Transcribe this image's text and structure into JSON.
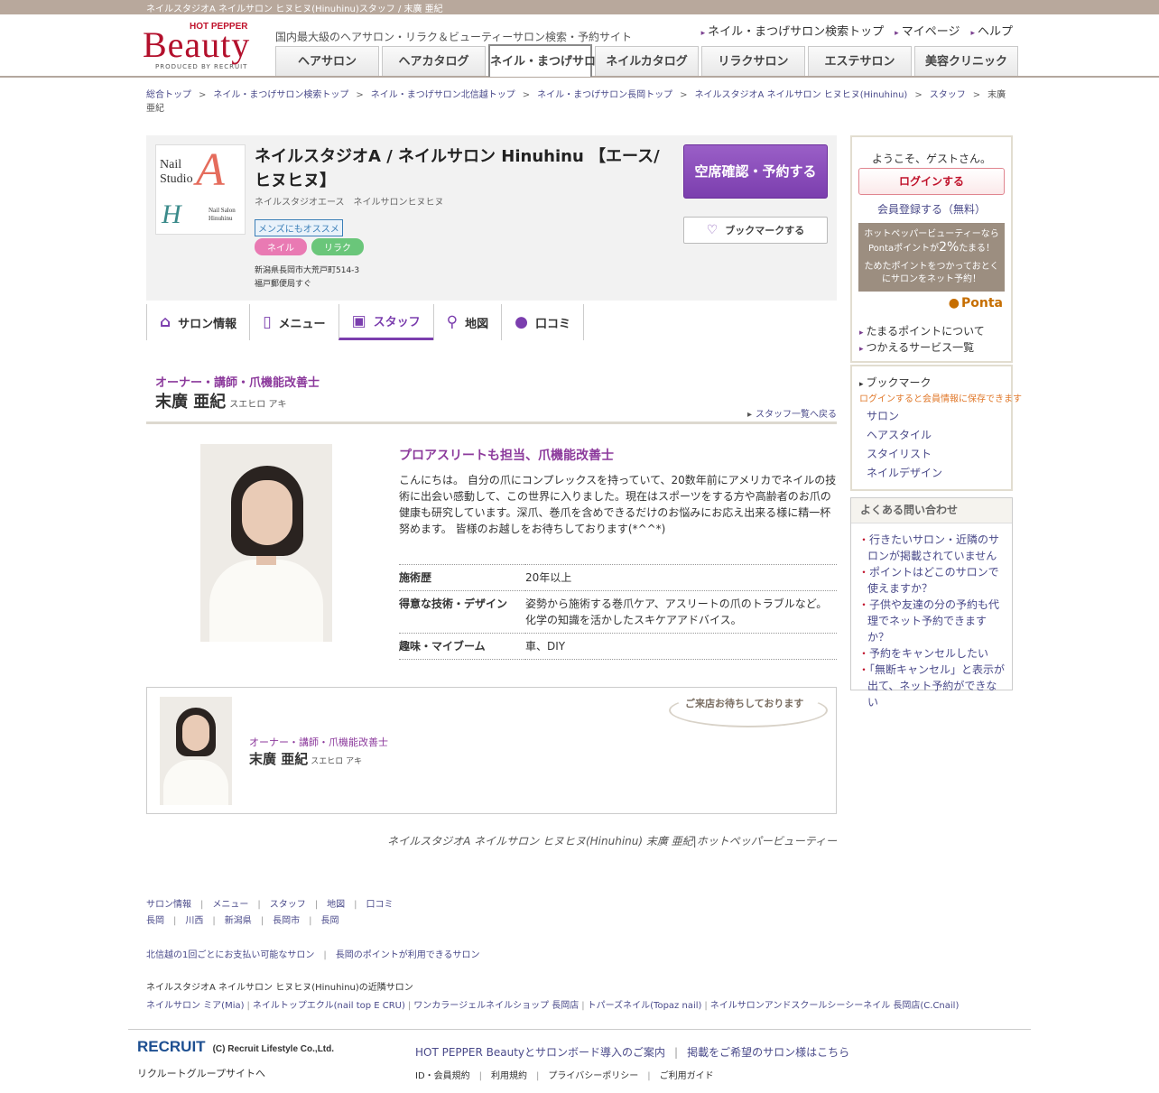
{
  "topbar": {
    "title": "ネイルスタジオA ネイルサロン ヒヌヒヌ(Hinuhinu)スタッフ / 末廣 亜紀"
  },
  "header": {
    "logo_hotpepper": "HOT PEPPER",
    "logo_beauty": "Beauty",
    "logo_produced": "PRODUCED BY RECRUIT",
    "tagline": "国内最大級のヘアサロン・リラク＆ビューティーサロン検索・予約サイト",
    "top_links": [
      "ネイル・まつげサロン検索トップ",
      "マイページ",
      "ヘルプ"
    ],
    "tabs": [
      "ヘアサロン",
      "ヘアカタログ",
      "ネイル・まつげサロン",
      "ネイルカタログ",
      "リラクサロン",
      "エステサロン",
      "美容クリニック"
    ],
    "active_tab": "ネイル・まつげサロン"
  },
  "breadcrumb": [
    "総合トップ",
    "ネイル・まつげサロン検索トップ",
    "ネイル・まつげサロン北信越トップ",
    "ネイル・まつげサロン長岡トップ",
    "ネイルスタジオA ネイルサロン ヒヌヒヌ(Hinuhinu)",
    "スタッフ",
    "末廣 亜紀"
  ],
  "breadcrumb_sep": ">",
  "salon": {
    "logo_text_1": "Nail",
    "logo_text_2": "Studio",
    "logo_letter_a": "A",
    "logo_letter_h": "H",
    "logo_sub_1": "Nail Salon",
    "logo_sub_2": "Hinuhinu",
    "name": "ネイルスタジオA / ネイルサロン Hinuhinu 【エース/ヒヌヒヌ】",
    "kana": "ネイルスタジオエース　ネイルサロンヒヌヒヌ",
    "mens_badge": "メンズにもオススメ",
    "tags": [
      "ネイル",
      "リラク"
    ],
    "address": "新潟県長岡市大荒戸町514-3",
    "access": "福戸郵便局すぐ",
    "reserve_label": "空席確認・予約する",
    "bookmark_label": "ブックマークする"
  },
  "subnav": [
    {
      "label": "サロン情報",
      "icon": "home-icon"
    },
    {
      "label": "メニュー",
      "icon": "menu-book-icon"
    },
    {
      "label": "スタッフ",
      "icon": "staff-card-icon"
    },
    {
      "label": "地図",
      "icon": "map-pin-icon"
    },
    {
      "label": "口コミ",
      "icon": "chat-bubble-icon"
    }
  ],
  "staff": {
    "role": "オーナー・講師・爪機能改善士",
    "name": "末廣 亜紀",
    "kana": "スエヒロ アキ",
    "back_link": "スタッフ一覧へ戻る",
    "catch": "プロアスリートも担当、爪機能改善士",
    "description": "こんにちは。 自分の爪にコンプレックスを持っていて、20数年前にアメリカでネイルの技術に出会い感動して、この世界に入りました。現在はスポーツをする方や高齢者のお爪の健康も研究しています。深爪、巻爪を含めできるだけのお悩みにお応え出来る様に精一杯努めます。 皆様のお越しをお待ちしております(*^^*)",
    "details": [
      {
        "key": "施術歴",
        "value": "20年以上"
      },
      {
        "key": "得意な技術・デザイン",
        "value": "姿勢から施術する巻爪ケア、アスリートの爪のトラブルなど。化学の知識を活かしたスキケアアドバイス。"
      },
      {
        "key": "趣味・マイブーム",
        "value": "車、DIY"
      }
    ]
  },
  "message_box": {
    "bubble": "ご来店お待ちしております",
    "role": "オーナー・講師・爪機能改善士",
    "name": "末廣 亜紀",
    "kana": "スエヒロ アキ"
  },
  "footline": "ネイルスタジオA ネイルサロン ヒヌヒヌ(Hinuhinu) 末廣 亜紀|ホットペッパービューティー",
  "sidebar": {
    "welcome": "ようこそ、ゲストさん。",
    "login": "ログインする",
    "register": "会員登録する（無料）",
    "ponta_line1": "ホットペッパービューティーなら",
    "ponta_line2a": "Pontaポイントが",
    "ponta_pct": "2%",
    "ponta_line2b": "たまる！",
    "ponta_line3": "ためたポイントをつかっておとくにサロンをネット予約！",
    "ponta_logo": "Ponta",
    "ponta_links": [
      "たまるポイントについて",
      "つかえるサービス一覧"
    ],
    "bookmark_title": "ブックマーク",
    "bookmark_note": "ログインすると会員情報に保存できます",
    "bookmark_items": [
      "サロン",
      "ヘアスタイル",
      "スタイリスト",
      "ネイルデザイン"
    ],
    "faq_title": "よくある問い合わせ",
    "faq": [
      "行きたいサロン・近隣のサロンが掲載されていません",
      "ポイントはどこのサロンで使えますか？",
      "子供や友達の分の予約も代理でネット予約できますか？",
      "予約をキャンセルしたい",
      "「無断キャンセル」と表示が出て、ネット予約ができない"
    ]
  },
  "footer": {
    "nav1": [
      "サロン情報",
      "メニュー",
      "スタッフ",
      "地図",
      "口コミ"
    ],
    "nav2": [
      "長岡",
      "川西",
      "新潟県",
      "長岡市",
      "長岡"
    ],
    "nav3": [
      "北信越の1回ごとにお支払い可能なサロン",
      "長岡のポイントが利用できるサロン"
    ],
    "near_title": "ネイルスタジオA ネイルサロン ヒヌヒヌ(Hinuhinu)の近隣サロン",
    "near": [
      "ネイルサロン ミア(Mia)",
      "ネイルトップエクル(nail top E CRU)",
      "ワンカラージェルネイルショップ 長岡店",
      "トパーズネイル(Topaz nail)",
      "ネイルサロンアンドスクールシーシーネイル 長岡店(C.Cnail)"
    ],
    "recruit_logo": "RECRUIT",
    "copyright": "(C) Recruit Lifestyle Co.,Ltd.",
    "recruit_group": "リクルートグループサイトへ",
    "main_links": [
      "HOT PEPPER Beautyとサロンボード導入のご案内",
      "掲載をご希望のサロン様はこちら"
    ],
    "sub_links": [
      "ID・会員規約",
      "利用規約",
      "プライバシーポリシー",
      "ご利用ガイド"
    ]
  },
  "colors": {
    "brand": "#b3102c",
    "accent_purple": "#7b3eae",
    "link": "#4a4a8a"
  }
}
